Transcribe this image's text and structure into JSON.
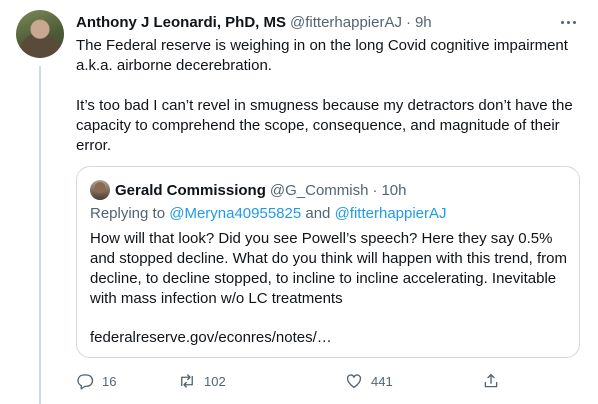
{
  "tweet": {
    "author_name": "Anthony J Leonardi, PhD, MS",
    "author_handle": "@fitterhappierAJ",
    "dot": "·",
    "time": "9h",
    "paragraphs": [
      "The Federal reserve is weighing in on the long Covid cognitive impairment a.k.a. airborne decerebration.",
      "It’s too bad I can’t revel in smugness because my detractors don’t have the capacity to comprehend the scope, consequence, and magnitude of their error."
    ]
  },
  "quote": {
    "author_name": "Gerald Commissiong",
    "author_handle": "@G_Commish",
    "dot": "·",
    "time": "10h",
    "replying_prefix": "Replying to ",
    "replying_user1": "@Meryna40955825",
    "replying_and": " and ",
    "replying_user2": "@fitterhappierAJ",
    "text": "How will that look? Did you see Powell’s speech? Here they say 0.5% and stopped decline. What do you think will happen with this trend, from decline, to decline stopped, to incline to incline accelerating. Inevitable with mass infection w/o LC treatments",
    "link": "federalreserve.gov/econres/notes/…"
  },
  "actions": {
    "reply_count": "16",
    "retweet_count": "102",
    "like_count": "441"
  },
  "icons": {
    "reply": "reply-icon",
    "retweet": "retweet-icon",
    "like": "heart-icon",
    "share": "share-icon",
    "more": "more-icon"
  },
  "colors": {
    "text": "#0f1419",
    "secondary": "#536471",
    "link": "#1d9bf0",
    "border": "#cfd9de"
  }
}
